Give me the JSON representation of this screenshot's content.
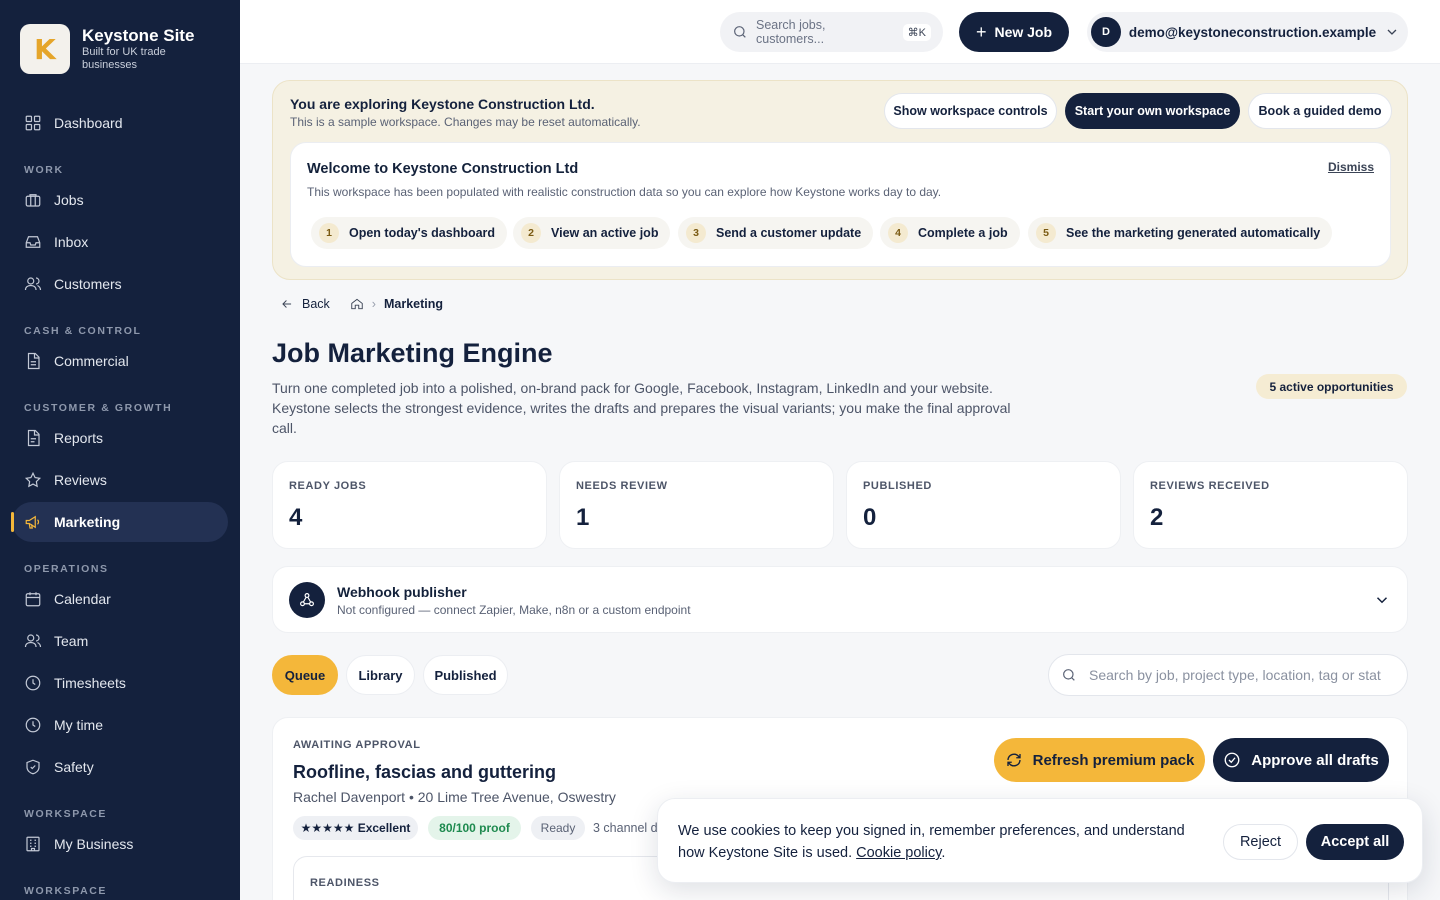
{
  "brand": {
    "logo_letter": "K",
    "name": "Keystone Site",
    "tagline": "Built for UK trade businesses"
  },
  "nav": {
    "dashboard": "Dashboard",
    "sections": {
      "work": "WORK",
      "cash": "CASH & CONTROL",
      "growth": "CUSTOMER & GROWTH",
      "operations": "OPERATIONS",
      "workspace1": "WORKSPACE",
      "workspace2": "WORKSPACE"
    },
    "items": {
      "jobs": "Jobs",
      "inbox": "Inbox",
      "customers": "Customers",
      "commercial": "Commercial",
      "reports": "Reports",
      "reviews": "Reviews",
      "marketing": "Marketing",
      "calendar": "Calendar",
      "team": "Team",
      "timesheets": "Timesheets",
      "my_time": "My time",
      "safety": "Safety",
      "my_business": "My Business"
    },
    "active": "marketing"
  },
  "topbar": {
    "search_placeholder": "Search jobs, customers...",
    "search_shortcut": "⌘K",
    "new_job": "New Job",
    "user_initial": "D",
    "user_email": "demo@keystoneconstruction.example"
  },
  "demo": {
    "title": "You are exploring Keystone Construction Ltd.",
    "subtitle": "This is a sample workspace. Changes may be reset automatically.",
    "show_controls": "Show workspace controls",
    "start_workspace": "Start your own workspace",
    "book_demo": "Book a guided demo",
    "welcome_title": "Welcome to Keystone Construction Ltd",
    "welcome_sub": "This workspace has been populated with realistic construction data so you can explore how Keystone works day to day.",
    "dismiss": "Dismiss",
    "steps": [
      {
        "num": "1",
        "label": "Open today's dashboard"
      },
      {
        "num": "2",
        "label": "View an active job"
      },
      {
        "num": "3",
        "label": "Send a customer update"
      },
      {
        "num": "4",
        "label": "Complete a job"
      },
      {
        "num": "5",
        "label": "See the marketing generated automatically"
      }
    ]
  },
  "breadcrumb": {
    "back": "Back",
    "current": "Marketing"
  },
  "page": {
    "title": "Job Marketing Engine",
    "description": "Turn one completed job into a polished, on-brand pack for Google, Facebook, Instagram, LinkedIn and your website. Keystone selects the strongest evidence, writes the drafts and prepares the visual variants; you make the final approval call.",
    "opportunities": "5 active opportunities"
  },
  "stats": [
    {
      "label": "READY JOBS",
      "value": "4"
    },
    {
      "label": "NEEDS REVIEW",
      "value": "1"
    },
    {
      "label": "PUBLISHED",
      "value": "0"
    },
    {
      "label": "REVIEWS RECEIVED",
      "value": "2"
    }
  ],
  "webhook": {
    "title": "Webhook publisher",
    "subtitle": "Not configured — connect Zapier, Make, n8n or a custom endpoint"
  },
  "tabs": {
    "queue": "Queue",
    "library": "Library",
    "published": "Published",
    "active": "queue"
  },
  "filter_placeholder": "Search by job, project type, location, tag or stat",
  "job": {
    "status": "AWAITING APPROVAL",
    "title": "Roofline, fascias and guttering",
    "meta": "Rachel Davenport • 20 Lime Tree Avenue, Oswestry",
    "rating": "★★★★★ Excellent",
    "proof": "80/100 proof",
    "ready": "Ready",
    "channels": "3 channel drafts",
    "refresh": "Refresh premium pack",
    "approve": "Approve all drafts",
    "readiness_label": "READINESS"
  },
  "cookie": {
    "text": "We use cookies to keep you signed in, remember preferences, and understand how Keystone Site is used.",
    "link": "Cookie policy",
    "reject": "Reject",
    "accept": "Accept all"
  },
  "colors": {
    "navy": "#14213d",
    "accent": "#f4b73a",
    "banner": "#f5f1e3",
    "proof_green": "#1e8a4f"
  }
}
